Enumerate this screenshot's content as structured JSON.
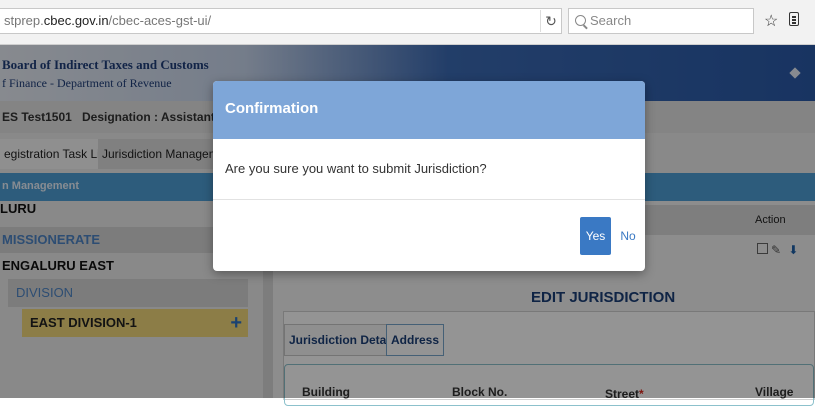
{
  "browser": {
    "url_prefix": "stprep.",
    "url_domain": "cbec.gov.in",
    "url_path": "/cbec-aces-gst-ui/",
    "reload_icon": "reload-icon",
    "search_placeholder": "Search",
    "bookmark_icon": "star-icon",
    "reader_icon": "clipboard-icon"
  },
  "header": {
    "org_name": "Board of Indirect Taxes and Customs",
    "dept": "f Finance - Department of Revenue"
  },
  "userbar": {
    "user": "ES Test1501",
    "designation": "Designation : Assistant Comm"
  },
  "tabs": [
    "egistration Task List",
    "Jurisdiction Management"
  ],
  "breadcrumb": "n Management",
  "tree": {
    "l1": "LURU",
    "l2": "MISSIONERATE",
    "l3": "ENGALURU EAST",
    "l4": "DIVISION",
    "l5": "EAST DIVISION-1",
    "add_icon": "+"
  },
  "grid": {
    "action_header": "Action"
  },
  "edit": {
    "title": "EDIT JURISDICTION",
    "subtabs": [
      "Jurisdiction Details",
      "Address"
    ],
    "columns": [
      "Building",
      "Block No.",
      "Street",
      "Village"
    ],
    "required_mark": "*"
  },
  "modal": {
    "title": "Confirmation",
    "message": "Are you sure you want to submit Jurisdiction?",
    "yes": "Yes",
    "no": "No"
  },
  "colors": {
    "modal_header": "#7ea6d8",
    "primary_button": "#3a79c4",
    "selected_tree_item": "#f2d87a"
  }
}
